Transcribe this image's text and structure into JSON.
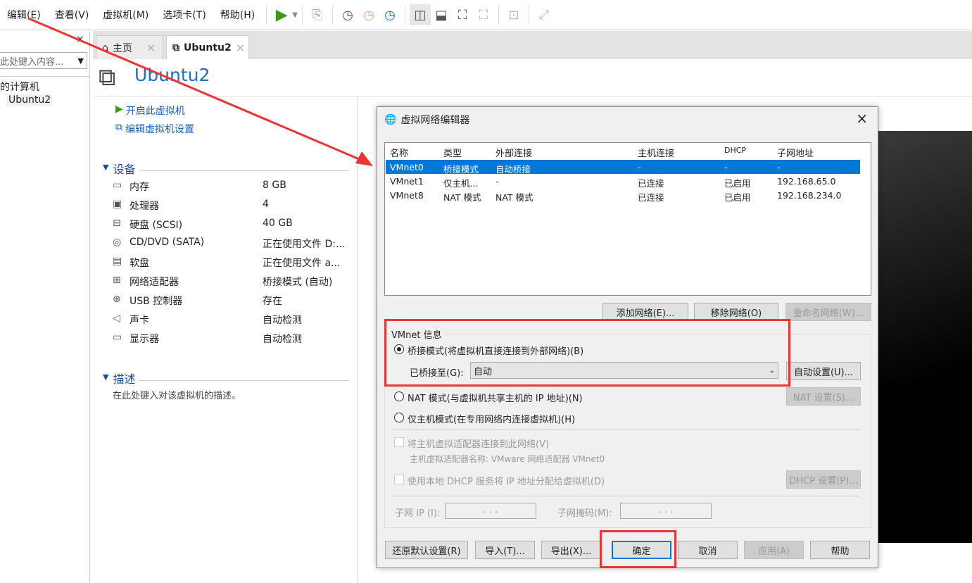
{
  "menu": [
    "编辑(E)",
    "查看(V)",
    "虚拟机(M)",
    "选项卡(T)",
    "帮助(H)"
  ],
  "sidebar": {
    "search_placeholder": "在此处键入内容...",
    "tree_root": "我的计算机",
    "tree_item": "Ubuntu2"
  },
  "tabs": [
    {
      "label": "主页"
    },
    {
      "label": "Ubuntu2"
    }
  ],
  "vm": {
    "title": "Ubuntu2",
    "actions": [
      "开启此虚拟机",
      "编辑虚拟机设置"
    ],
    "devices_header": "设备",
    "devices": [
      [
        "内存",
        "8 GB"
      ],
      [
        "处理器",
        "4"
      ],
      [
        "硬盘 (SCSI)",
        "40 GB"
      ],
      [
        "CD/DVD (SATA)",
        "正在使用文件 D:..."
      ],
      [
        "软盘",
        "正在使用文件 a..."
      ],
      [
        "网络适配器",
        "桥接模式 (自动)"
      ],
      [
        "USB 控制器",
        "存在"
      ],
      [
        "声卡",
        "自动检测"
      ],
      [
        "显示器",
        "自动检测"
      ]
    ],
    "desc_header": "描述",
    "desc_placeholder": "在此处键入对该虚拟机的描述。"
  },
  "dialog": {
    "title": "虚拟网络编辑器",
    "columns": [
      "名称",
      "类型",
      "外部连接",
      "主机连接",
      "DHCP",
      "子网地址"
    ],
    "rows": [
      [
        "VMnet0",
        "桥接模式",
        "自动桥接",
        "-",
        "-",
        "-"
      ],
      [
        "VMnet1",
        "仅主机...",
        "-",
        "已连接",
        "已启用",
        "192.168.65.0"
      ],
      [
        "VMnet8",
        "NAT 模式",
        "NAT 模式",
        "已连接",
        "已启用",
        "192.168.234.0"
      ]
    ],
    "selected_row": 0,
    "list_buttons": [
      "添加网络(E)...",
      "移除网络(O)",
      "重命名网络(W)..."
    ],
    "group_title": "VMnet 信息",
    "bridge_label": "桥接模式(将虚拟机直接连接到外部网络)(B)",
    "bridged_to_label": "已桥接至(G):",
    "bridged_to_value": "自动",
    "auto_settings": "自动设置(U)...",
    "nat_label": "NAT 模式(与虚拟机共享主机的 IP 地址)(N)",
    "nat_settings": "NAT 设置(S)...",
    "hostonly_label": "仅主机模式(在专用网络内连接虚拟机)(H)",
    "connect_adapter": "将主机虚拟适配器连接到此网络(V)",
    "adapter_name": "主机虚拟适配器名称: VMware 网络适配器 VMnet0",
    "use_dhcp": "使用本地 DHCP 服务将 IP 地址分配给虚拟机(D)",
    "dhcp_settings": "DHCP 设置(P)...",
    "subnet_ip": "子网 IP (I):",
    "subnet_mask": "子网掩码(M):",
    "ip_placeholder": ".   .   .",
    "footer": [
      "还原默认设置(R)",
      "导入(T)...",
      "导出(X)...",
      "确定",
      "取消",
      "应用(A)",
      "帮助"
    ],
    "selected_mode": "bridged"
  },
  "colors": {
    "accent": "#0078d7",
    "annotation": "#ee3333",
    "title_blue": "#1a6fc9"
  }
}
